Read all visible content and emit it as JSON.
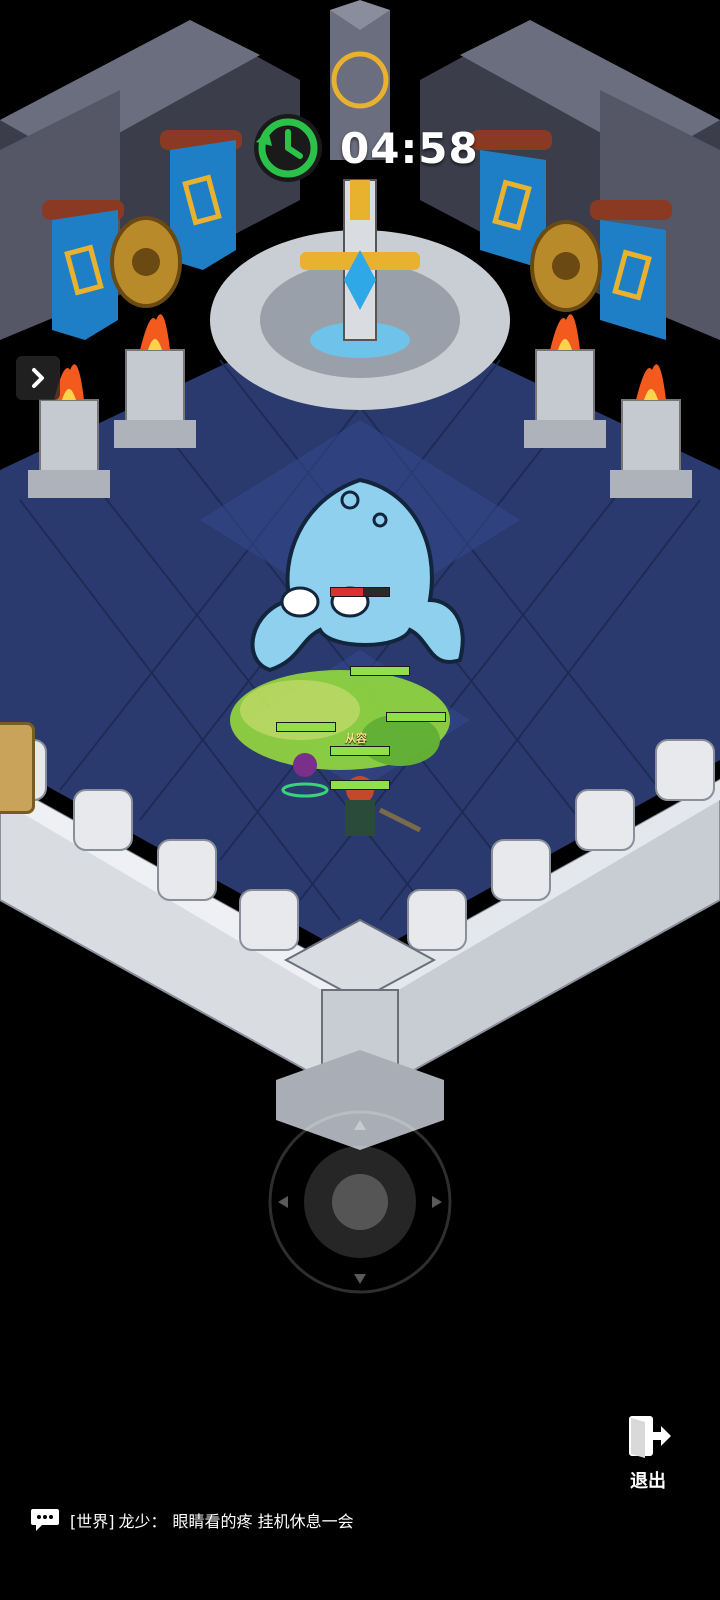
{
  "hud": {
    "timer_text": "04:58",
    "timer_icon": "clock-rewind-icon",
    "exit_label": "退出",
    "exit_icon": "exit-door-icon",
    "side_toggle_icon": "chevron-right-icon"
  },
  "chat": {
    "icon": "chat-bubble-icon",
    "channel": "[世界]",
    "sender": "龙少：",
    "message": "眼睛看的疼 挂机休息一会"
  },
  "battle": {
    "ally_label": "从容",
    "boss_hp_fraction": 0.55
  },
  "colors": {
    "floor": "#2a3a6e",
    "wall": "#d9dde2",
    "banner": "#1f7fc6",
    "hp_green": "#8fe04a",
    "hp_red": "#d9322e",
    "boss": "#8fd0ee",
    "timer_green": "#2bc24a"
  }
}
